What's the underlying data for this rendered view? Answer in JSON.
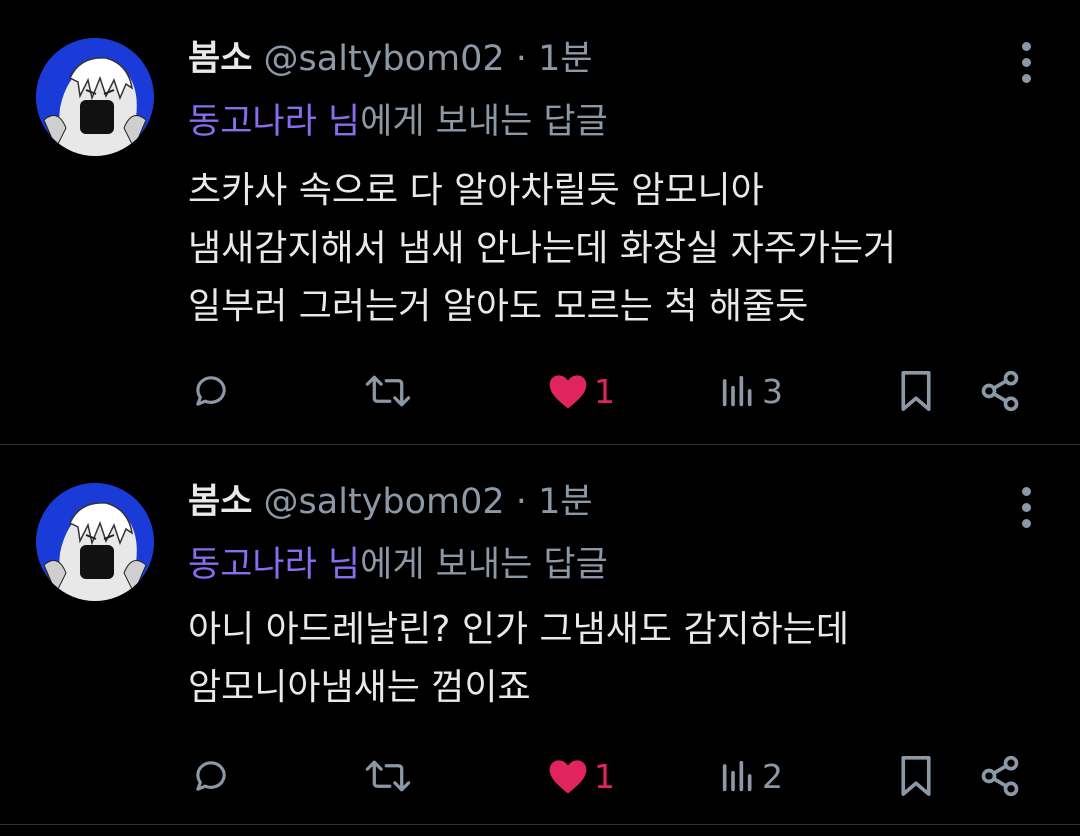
{
  "posts": [
    {
      "name": "봄소",
      "handle": "@saltybom02",
      "dot": "·",
      "time": "1분",
      "reply_to_name": "동고나라 님",
      "reply_to_suffix": "에게 보내는 답글",
      "text": "츠카사 속으로 다 알아차릴듯 암모니아\n냄새감지해서 냄새 안나는데 화장실 자주가는거\n일부러 그러는거 알아도 모르는 척 해줄듯",
      "like_count": "1",
      "view_count": "3"
    },
    {
      "name": "봄소",
      "handle": "@saltybom02",
      "dot": "·",
      "time": "1분",
      "reply_to_name": "동고나라 님",
      "reply_to_suffix": "에게 보내는 답글",
      "text": "아니 아드레날린? 인가 그냄새도 감지하는데\n암모니아냄새는 껌이죠",
      "like_count": "1",
      "view_count": "2"
    }
  ],
  "colors": {
    "background": "#000000",
    "text": "#e7e9ea",
    "muted": "#8b98a5",
    "mention": "#8a6cf0",
    "like": "#e0245e",
    "avatar_bg": "#1a3bd8"
  },
  "icons": [
    "reply-icon",
    "repost-icon",
    "heart-icon",
    "views-icon",
    "bookmark-icon",
    "share-icon",
    "more-icon"
  ]
}
